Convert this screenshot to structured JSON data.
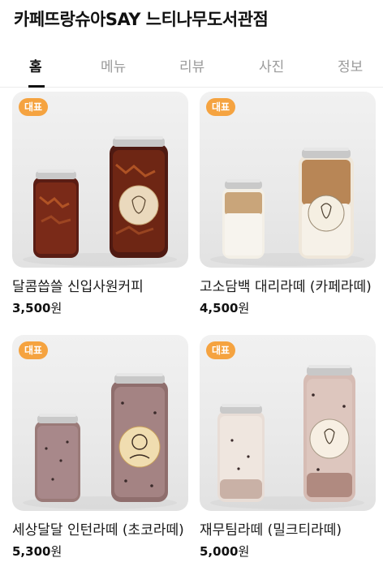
{
  "store": {
    "title": "카페뜨랑슈아SAY 느티나무도서관점"
  },
  "tabs": [
    {
      "label": "홈",
      "active": true
    },
    {
      "label": "메뉴",
      "active": false
    },
    {
      "label": "리뷰",
      "active": false
    },
    {
      "label": "사진",
      "active": false
    },
    {
      "label": "정보",
      "active": false
    }
  ],
  "menu": [
    {
      "badge": "대표",
      "name": "달콤씁쓸 신입사원커피",
      "price": "3,500",
      "unit": "원",
      "drink": "iced-americano"
    },
    {
      "badge": "대표",
      "name": "고소담백 대리라떼 (카페라떼)",
      "price": "4,500",
      "unit": "원",
      "drink": "cafe-latte"
    },
    {
      "badge": "대표",
      "name": "세상달달 인턴라떼 (초코라떼)",
      "price": "5,300",
      "unit": "원",
      "drink": "choco-latte"
    },
    {
      "badge": "대표",
      "name": "재무팀라떼 (밀크티라떼)",
      "price": "5,000",
      "unit": "원",
      "drink": "milk-tea-latte"
    }
  ],
  "colors": {
    "badge": "#f5a340",
    "active_tab": "#111111",
    "inactive_tab": "#9a9a9a"
  }
}
